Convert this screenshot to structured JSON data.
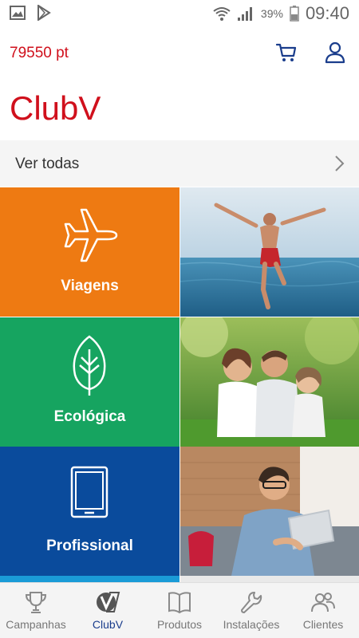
{
  "status_bar": {
    "battery_percent": "39%",
    "time": "09:40"
  },
  "header": {
    "points": "79550 pt",
    "cart_icon": "cart-icon",
    "user_icon": "user-icon"
  },
  "page": {
    "title": "ClubV"
  },
  "see_all": {
    "label": "Ver todas"
  },
  "categories": [
    {
      "label": "Viagens",
      "icon": "airplane-icon",
      "color": "#ee7a12"
    },
    {
      "label": "Ecológica",
      "icon": "leaf-icon",
      "color": "#16a460"
    },
    {
      "label": "Profissional",
      "icon": "tablet-icon",
      "color": "#0a4b9c"
    }
  ],
  "bottom_nav": [
    {
      "label": "Campanhas",
      "icon": "trophy-icon"
    },
    {
      "label": "ClubV",
      "icon": "clubv-icon",
      "active": true
    },
    {
      "label": "Produtos",
      "icon": "book-icon"
    },
    {
      "label": "Instalações",
      "icon": "wrench-icon"
    },
    {
      "label": "Clientes",
      "icon": "people-icon"
    }
  ],
  "colors": {
    "brand_red": "#d0101c",
    "nav_active": "#1a3d8c"
  }
}
